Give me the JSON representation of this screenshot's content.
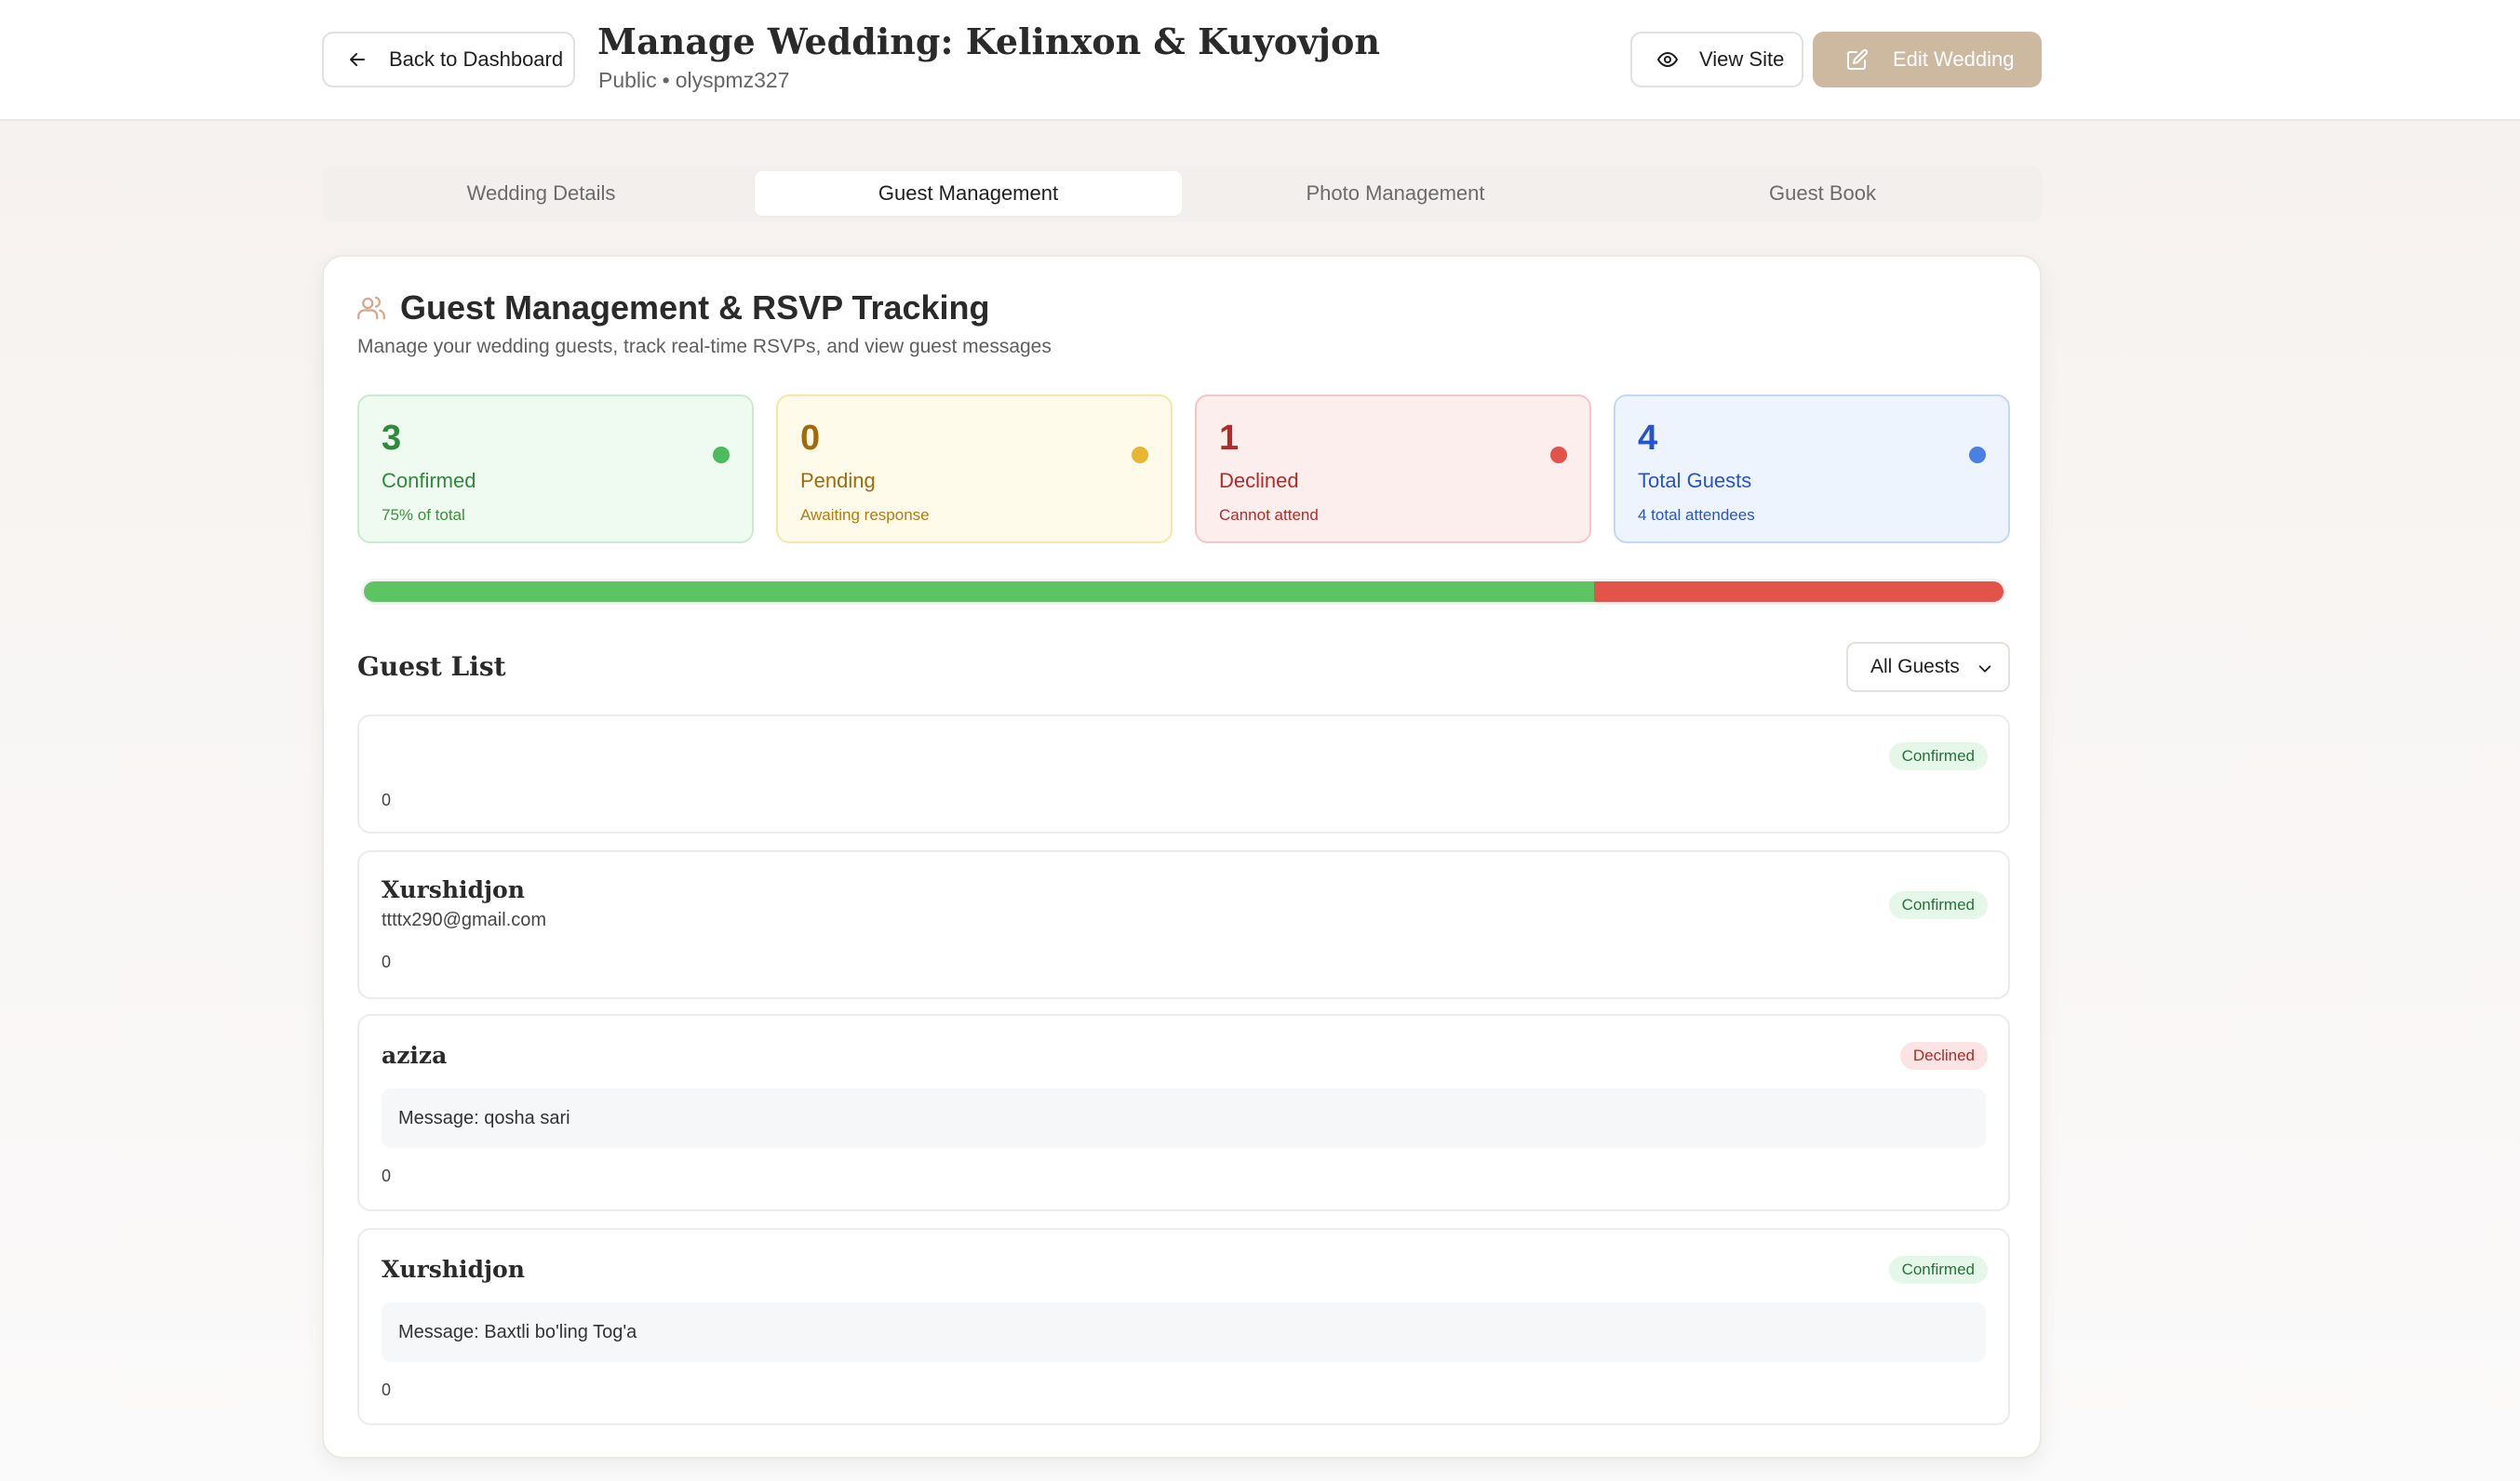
{
  "header": {
    "back_label": "Back to Dashboard",
    "title": "Manage Wedding: Kelinxon & Kuyovjon",
    "visibility": "Public",
    "separator": "•",
    "slug": "olyspmz327",
    "view_site_label": "View Site",
    "edit_label": "Edit Wedding"
  },
  "tabs": [
    {
      "label": "Wedding Details",
      "active": false
    },
    {
      "label": "Guest Management",
      "active": true
    },
    {
      "label": "Photo Management",
      "active": false
    },
    {
      "label": "Guest Book",
      "active": false
    }
  ],
  "guest_section": {
    "title": "Guest Management & RSVP Tracking",
    "description": "Manage your wedding guests, track real-time RSVPs, and view guest messages",
    "icon": "users-icon"
  },
  "stats": [
    {
      "key": "confirmed",
      "value": "3",
      "label": "Confirmed",
      "sub": "75% of total",
      "color": "#4cbb5c"
    },
    {
      "key": "pending",
      "value": "0",
      "label": "Pending",
      "sub": "Awaiting response",
      "color": "#e9b634"
    },
    {
      "key": "declined",
      "value": "1",
      "label": "Declined",
      "sub": "Cannot attend",
      "color": "#e2534a"
    },
    {
      "key": "total",
      "value": "4",
      "label": "Total Guests",
      "sub": "4 total attendees",
      "color": "#4a80e2"
    }
  ],
  "rsvp_progress": {
    "confirmed": 0.75,
    "pending": 0.0,
    "declined": 0.25
  },
  "guest_list": {
    "title": "Guest List",
    "filter_selected": "All Guests",
    "guests": [
      {
        "name": "",
        "email": "",
        "status": "Confirmed",
        "message": "",
        "count": "0"
      },
      {
        "name": "Xurshidjon",
        "email": "ttttx290@gmail.com",
        "status": "Confirmed",
        "message": "",
        "count": "0"
      },
      {
        "name": "aziza",
        "email": "",
        "status": "Declined",
        "message": "Message: qosha sari",
        "count": "0"
      },
      {
        "name": "Xurshidjon",
        "email": "",
        "status": "Confirmed",
        "message": "Message: Baxtli bo'ling Tog'a",
        "count": "0"
      }
    ]
  }
}
